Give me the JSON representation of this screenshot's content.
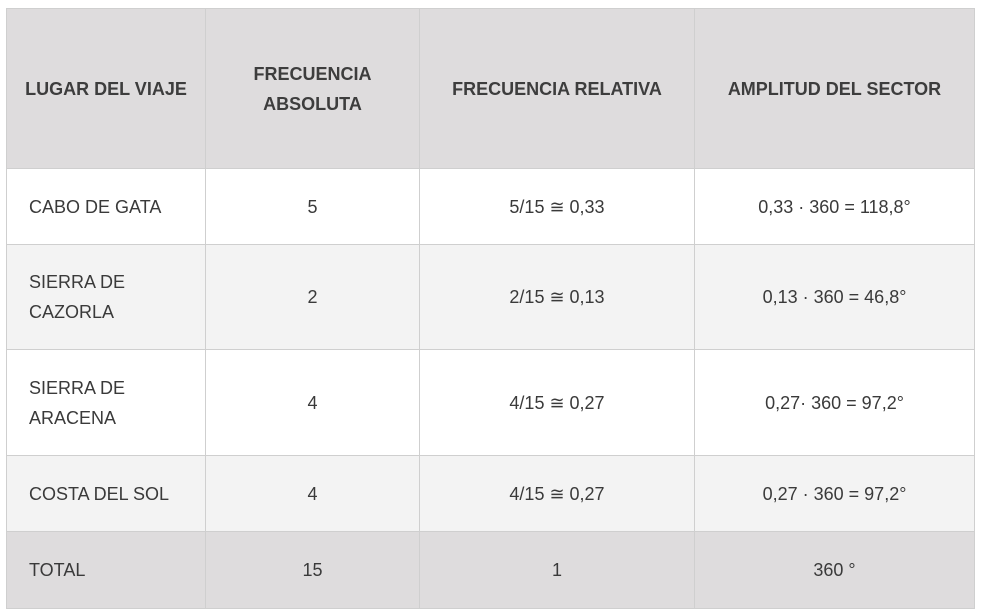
{
  "table": {
    "headers": [
      "LUGAR DEL VIAJE",
      "FRECUENCIA ABSOLUTA",
      "FRECUENCIA RELATIVA",
      "AMPLITUD DEL SECTOR"
    ],
    "rows": [
      {
        "place": "CABO DE GATA",
        "absolute": "5",
        "relative": "5/15 ≅ 0,33",
        "sector": "0,33 · 360 = 118,8°"
      },
      {
        "place": "SIERRA DE CAZORLA",
        "absolute": "2",
        "relative": "2/15 ≅ 0,13",
        "sector": "0,13 · 360 = 46,8°"
      },
      {
        "place": "SIERRA DE ARACENA",
        "absolute": "4",
        "relative": "4/15 ≅ 0,27",
        "sector": "0,27· 360 = 97,2°"
      },
      {
        "place": "COSTA DEL SOL",
        "absolute": "4",
        "relative": "4/15 ≅ 0,27",
        "sector": "0,27 · 360 = 97,2°"
      }
    ],
    "total": {
      "place": "TOTAL",
      "absolute": "15",
      "relative": "1",
      "sector": "360 °"
    }
  }
}
